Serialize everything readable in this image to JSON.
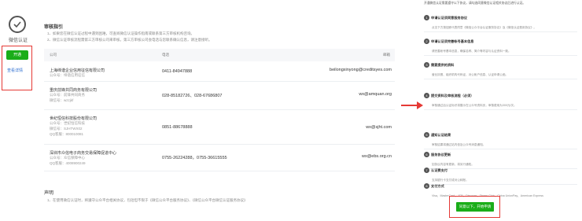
{
  "left": {
    "title": "微信认证",
    "open_button": "开通",
    "open_link": "查看详情"
  },
  "notice": {
    "title": "审核指引",
    "lines": [
      "1、如果您在微信认证过程中遇到困难，可查阅微信认证操作指南或联系第三方审核机构咨询。",
      "2、微信认证审核流程需第三方审核公司来审核，第三方审核公司会电话与您联系确认信息，请注意接听。"
    ]
  },
  "table": {
    "headers": [
      "公司",
      "电话",
      "邮箱"
    ],
    "rows": [
      {
        "name": "上海缔谐企业信用征信有限公司",
        "subs": [
          "公众号：缔谐信用征信"
        ],
        "phone": "0411-84947888",
        "email": "beilongxinyong@creditsyes.com"
      },
      {
        "name": "重庆前锋共同商务有限公司",
        "subs": [
          "公众号：前锋共同商务",
          "微信号：wzzjkf"
        ],
        "phone": "028-85182726、028-67686807",
        "email": "wx@amquan.org"
      },
      {
        "name": "世纪恒信科技股份有限公司",
        "subs": [
          "公众号：世纪恒信科技",
          "微信号：SJHTWX02",
          "QQ客服：800010081"
        ],
        "phone": "0851-88678888",
        "email": "wx@sjht.com"
      },
      {
        "name": "深圳市众信电子商务交易保障促进中心",
        "subs": [
          "公众号：众信保障中心",
          "QQ客服：4008900249"
        ],
        "phone": "0755-26224288，0755-36615555",
        "email": "wx@ebs.org.cn"
      }
    ]
  },
  "statement": {
    "title": "声明",
    "text": "1、在使用微信认证时，将遵守公众平台相关协议，包括但不限于《微信公众平台服务协议》、《微信公众平台微信认证服务协议》"
  },
  "right_panel": {
    "intro": "开通微信认证需要遵守以下协议，请勾选同意微信认证相关协议后进行认证。",
    "blocks": [
      {
        "num": "1",
        "head": "申请认证须同意服务协议",
        "text": "点击下方按钮即代表同意《微信公众平台认证服务协议》及《微信认证费用协议》。"
      },
      {
        "num": "2",
        "head": "申请认证须完善帐号基本信息",
        "text": "请完善帐号基本信息，确保名称、简介等内容与认证资料一致。"
      },
      {
        "num": "3",
        "head": "需要提供的资料",
        "text": "营业执照、组织机构代码证、对公帐户信息、认证申请公函。"
      },
      {
        "num": "4",
        "head": "提交资料及审核流程（必须）",
        "text": "审核通过后认证标识将展示在公众号资料页，审核费用为300元/次。"
      },
      {
        "num": "5",
        "head": "通知认证结果",
        "text": "审核结果将通过站内信及公众号消息通知。"
      },
      {
        "num": "6",
        "head": "服务协议更新",
        "text": "如协议内容有更新，将另行通知。"
      },
      {
        "num": "7",
        "head": "认证费支付",
        "text": "支持银行卡支付或对公转账。"
      },
      {
        "num": "8",
        "head": "支付方式",
        "text": "Visa、MasterCard、JCB、Discover、Diners Club、China UnionPay、American Express"
      }
    ],
    "agree_button": "同意以下，开始申请"
  },
  "colors": {
    "primary_green": "#1aad19",
    "highlight_red": "#e53935",
    "link_blue": "#2f6fd1"
  }
}
